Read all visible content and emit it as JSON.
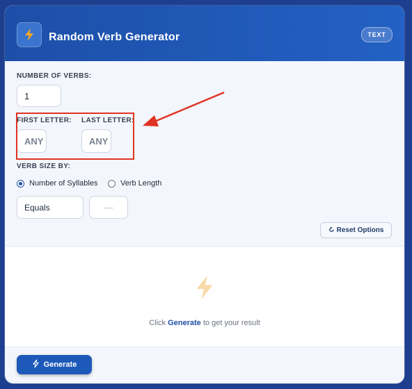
{
  "header": {
    "title": "Random Verb Generator",
    "tag": "TEXT"
  },
  "options": {
    "number_of_verbs": {
      "label": "NUMBER OF VERBS:",
      "value": "1"
    },
    "first_letter": {
      "label": "FIRST LETTER:",
      "placeholder": "ANY"
    },
    "last_letter": {
      "label": "LAST LETTER:",
      "placeholder": "ANY"
    },
    "verb_size": {
      "label": "VERB SIZE BY:",
      "radios": [
        {
          "label": "Number of Syllables",
          "selected": true
        },
        {
          "label": "Verb Length",
          "selected": false
        }
      ],
      "comparison": "Equals",
      "amount_placeholder": "—"
    },
    "reset_label": "Reset Options",
    "reset_icon": "refresh-icon"
  },
  "result": {
    "icon": "lightning-icon",
    "prefix": "Click",
    "keyword": "Generate",
    "suffix": "to get your result"
  },
  "footer": {
    "generate_label": "Generate",
    "generate_icon": "lightning-icon"
  },
  "annotation": {
    "box_color": "#e03323"
  },
  "colors": {
    "accent": "#1d4fa8",
    "lightning_orange": "#f5a623"
  }
}
